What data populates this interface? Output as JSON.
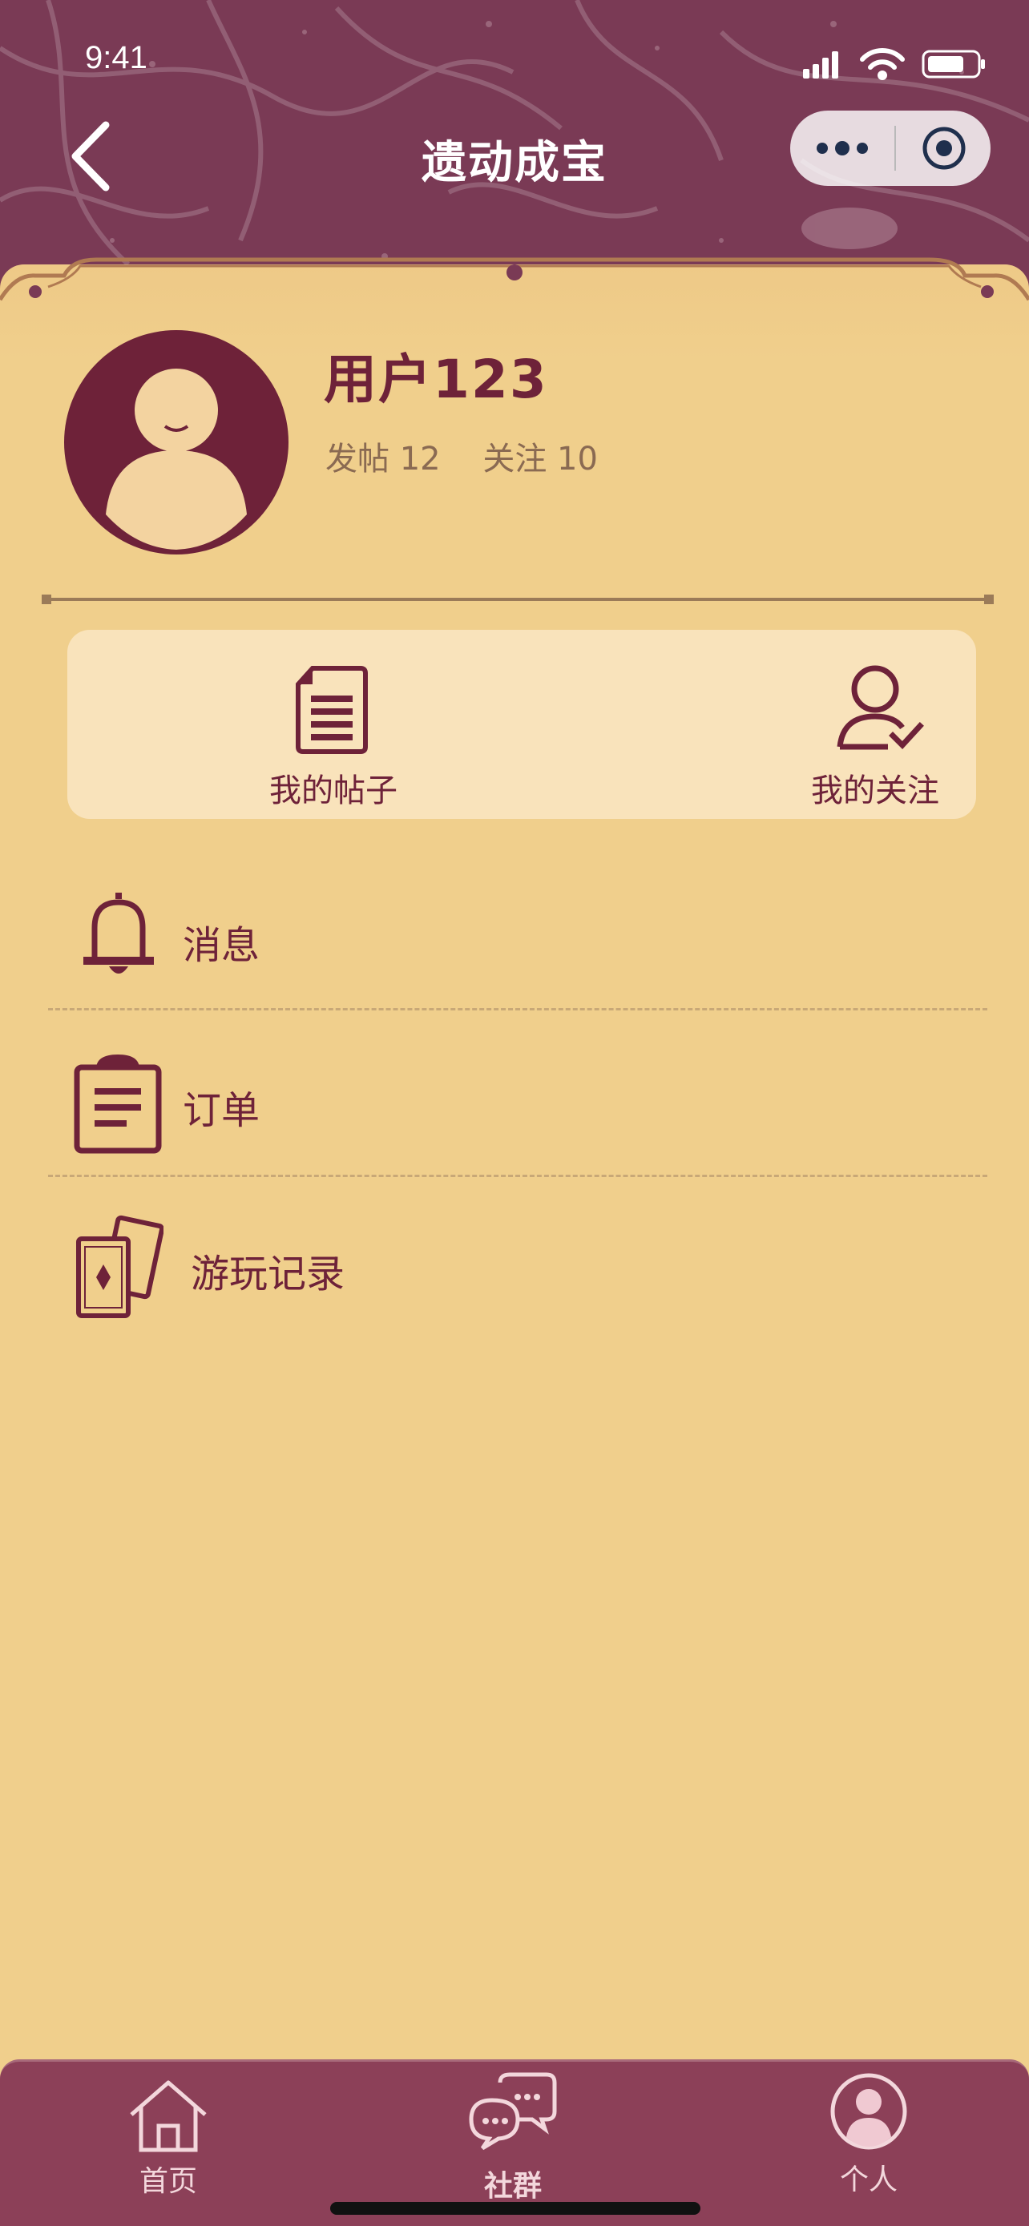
{
  "status_bar": {
    "time": "9:41"
  },
  "nav": {
    "title": "遗动成宝"
  },
  "profile": {
    "username": "用户123",
    "posts_label": "发帖 12",
    "following_label": "关注 10"
  },
  "quick_actions": [
    {
      "label": "我的帖子",
      "icon": "document-icon"
    },
    {
      "label": "我的关注",
      "icon": "user-check-icon"
    }
  ],
  "menu": [
    {
      "label": "消息",
      "icon": "bell-icon"
    },
    {
      "label": "订单",
      "icon": "clipboard-icon"
    },
    {
      "label": "游玩记录",
      "icon": "cards-icon"
    }
  ],
  "tabbar": [
    {
      "label": "首页",
      "icon": "home-icon"
    },
    {
      "label": "社群",
      "icon": "chat-bubbles-icon"
    },
    {
      "label": "个人",
      "icon": "person-icon"
    }
  ],
  "colors": {
    "header_bg": "#7a3a55",
    "card_bg": "#f0cf8c",
    "accent": "#6e2239",
    "tabbar_bg": "#8c4058"
  }
}
